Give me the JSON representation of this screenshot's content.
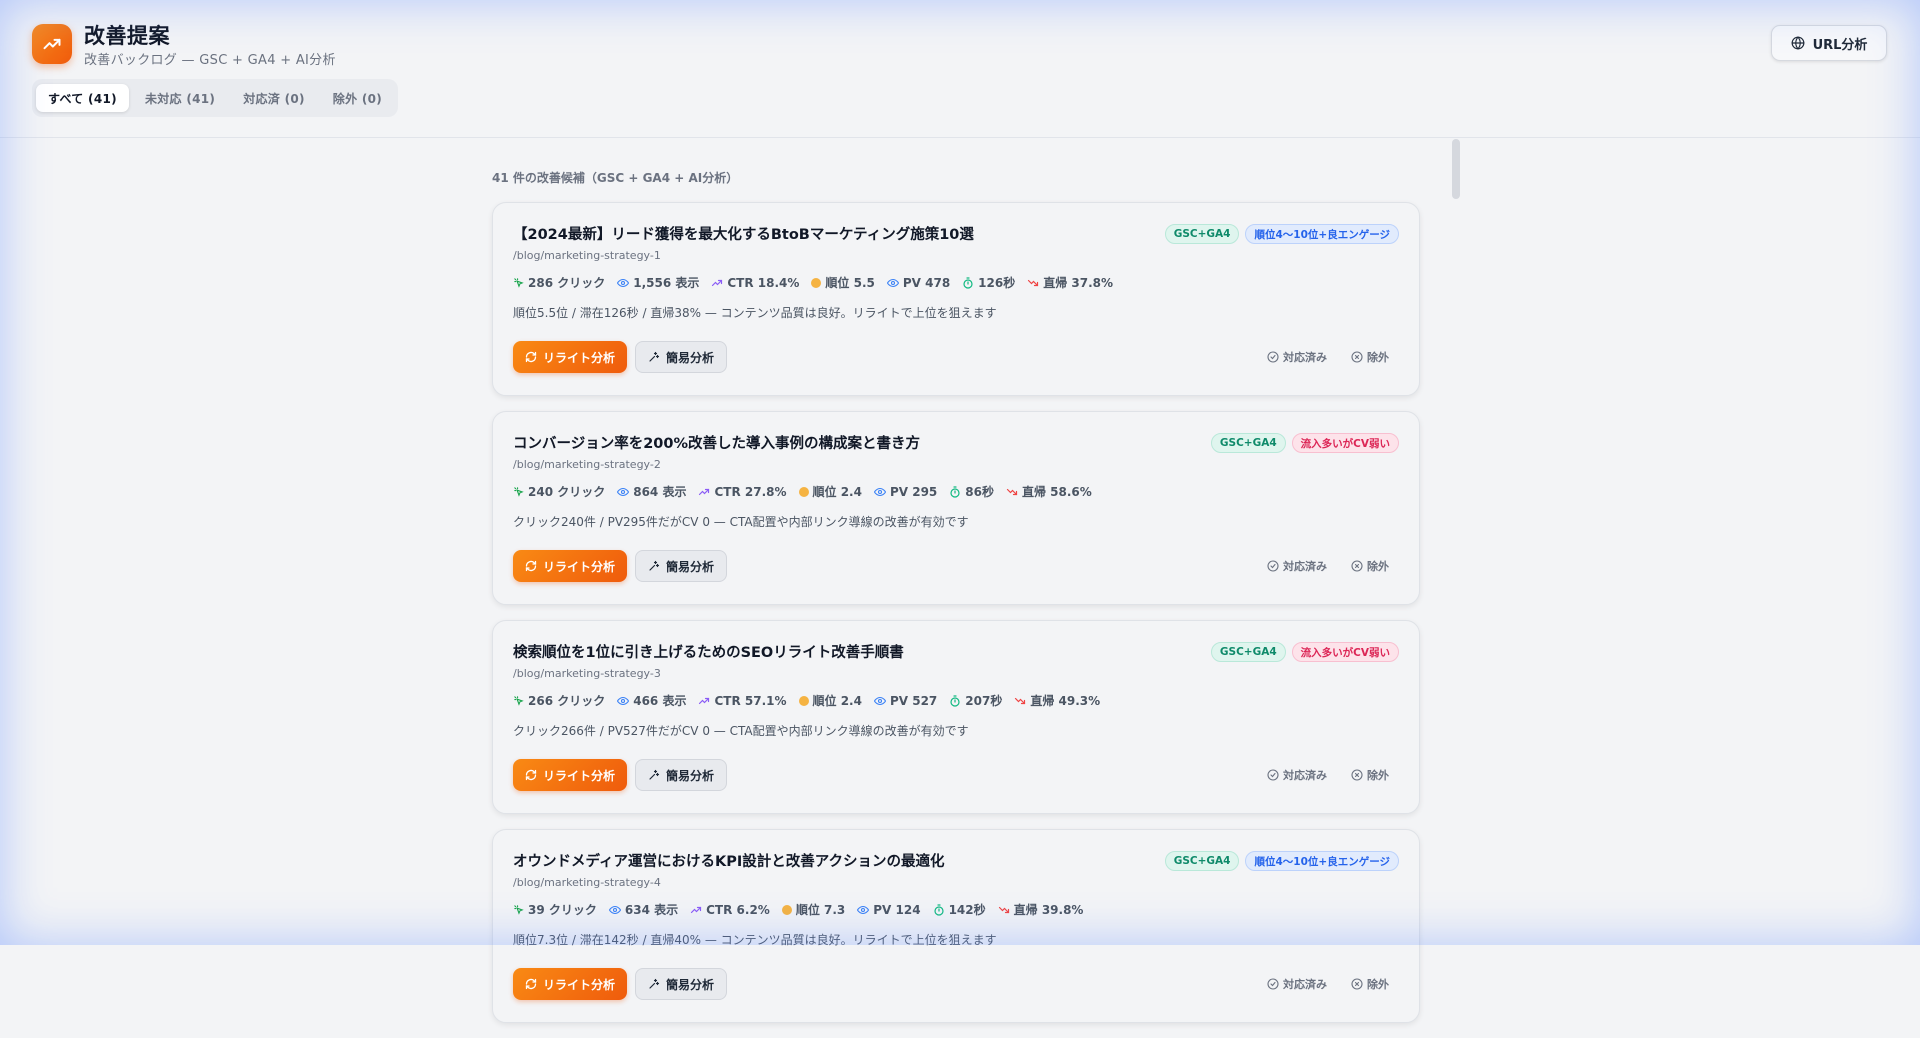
{
  "header": {
    "title": "改善提案",
    "subtitle": "改善バックログ — GSC + GA4 + AI分析",
    "url_button": "URL分析",
    "tabs": [
      {
        "label": "すべて (41)",
        "active": true
      },
      {
        "label": "未対応 (41)",
        "active": false
      },
      {
        "label": "対応済 (0)",
        "active": false
      },
      {
        "label": "除外 (0)",
        "active": false
      }
    ]
  },
  "summary": "41 件の改善候補（GSC + GA4 + AI分析）",
  "labels": {
    "rewrite": "リライト分析",
    "quick": "簡易分析",
    "done": "対応済み",
    "exclude": "除外"
  },
  "colors": {
    "accent": "#f97316",
    "badge_source": "#0f8a6a",
    "badge_blue": "#2563eb",
    "badge_red": "#dc2656"
  },
  "cards": [
    {
      "title": "【2024最新】リード獲得を最大化するBtoBマーケティング施策10選",
      "path": "/blog/marketing-strategy-1",
      "source_badge": "GSC+GA4",
      "type_badge": "順位4〜10位+良エンゲージ",
      "clicks": "286 クリック",
      "impressions": "1,556 表示",
      "ctr": "CTR 18.4%",
      "rank": "順位 5.5",
      "pv": "PV 478",
      "dwell": "126秒",
      "bounce": "直帰 37.8%",
      "note": "順位5.5位 / 滞在126秒 / 直帰38% — コンテンツ品質は良好。リライトで上位を狙えます"
    },
    {
      "title": "コンバージョン率を200%改善した導入事例の構成案と書き方",
      "path": "/blog/marketing-strategy-2",
      "source_badge": "GSC+GA4",
      "type_badge": "流入多いがCV弱い",
      "clicks": "240 クリック",
      "impressions": "864 表示",
      "ctr": "CTR 27.8%",
      "rank": "順位 2.4",
      "pv": "PV 295",
      "dwell": "86秒",
      "bounce": "直帰 58.6%",
      "note": "クリック240件 / PV295件だがCV 0 — CTA配置や内部リンク導線の改善が有効です"
    },
    {
      "title": "検索順位を1位に引き上げるためのSEOリライト改善手順書",
      "path": "/blog/marketing-strategy-3",
      "source_badge": "GSC+GA4",
      "type_badge": "流入多いがCV弱い",
      "clicks": "266 クリック",
      "impressions": "466 表示",
      "ctr": "CTR 57.1%",
      "rank": "順位 2.4",
      "pv": "PV 527",
      "dwell": "207秒",
      "bounce": "直帰 49.3%",
      "note": "クリック266件 / PV527件だがCV 0 — CTA配置や内部リンク導線の改善が有効です"
    },
    {
      "title": "オウンドメディア運営におけるKPI設計と改善アクションの最適化",
      "path": "/blog/marketing-strategy-4",
      "source_badge": "GSC+GA4",
      "type_badge": "順位4〜10位+良エンゲージ",
      "clicks": "39 クリック",
      "impressions": "634 表示",
      "ctr": "CTR 6.2%",
      "rank": "順位 7.3",
      "pv": "PV 124",
      "dwell": "142秒",
      "bounce": "直帰 39.8%",
      "note": "順位7.3位 / 滞在142秒 / 直帰40% — コンテンツ品質は良好。リライトで上位を狙えます"
    }
  ]
}
